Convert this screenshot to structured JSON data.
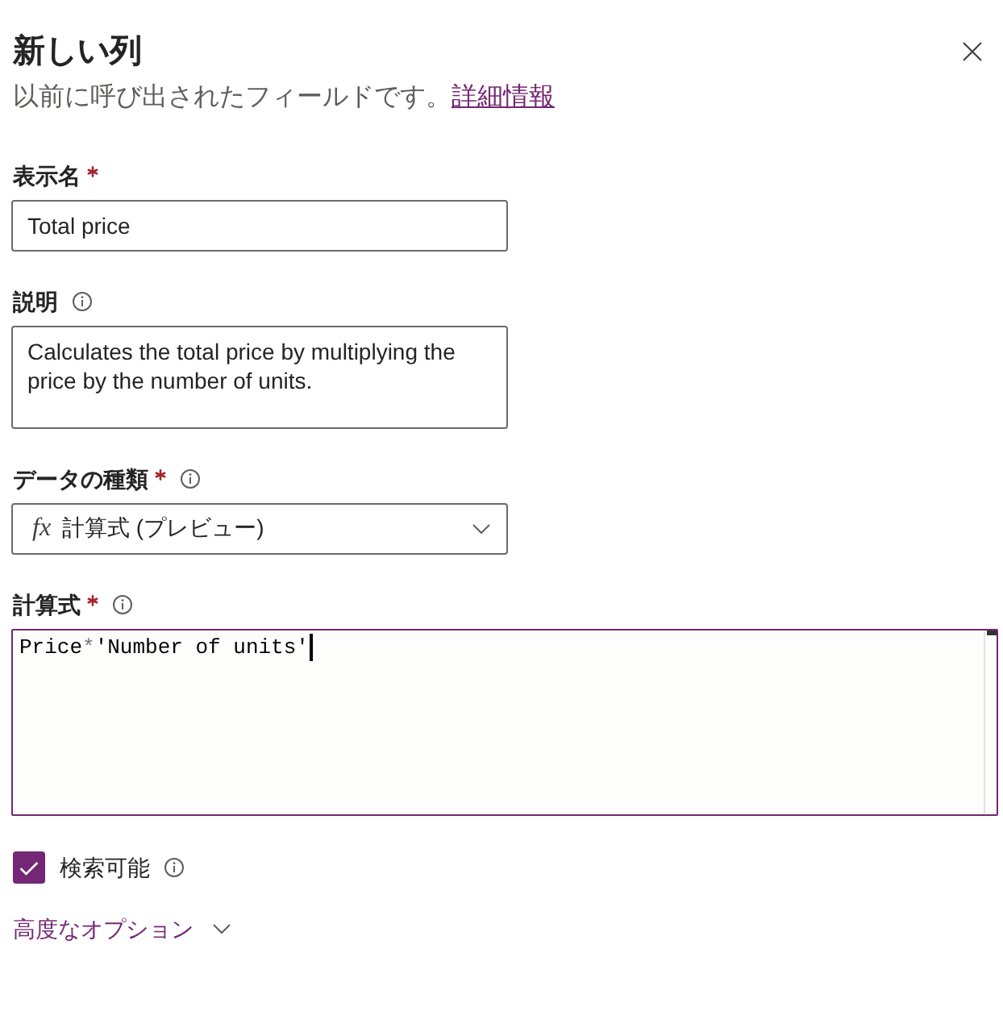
{
  "panel": {
    "title": "新しい列",
    "subtitle": "以前に呼び出されたフィールドです。",
    "link": "詳細情報"
  },
  "fields": [
    {
      "kind": "text",
      "label": "表示名",
      "required": true,
      "info": false,
      "value": "Total price"
    },
    {
      "kind": "textarea",
      "label": "説明",
      "required": false,
      "info": true,
      "value": "Calculates the total price by multiplying the price by the number of units."
    },
    {
      "kind": "dropdown",
      "label": "データの種類",
      "required": true,
      "info": true,
      "symbol": "fx",
      "value": "計算式 (プレビュー)"
    },
    {
      "kind": "formula",
      "label": "計算式",
      "required": true,
      "info": true,
      "focused": true,
      "tokens": [
        {
          "kind": "identifier",
          "text": "Price"
        },
        {
          "kind": "operator",
          "text": "*"
        },
        {
          "kind": "identifier",
          "text": "'Number of units'"
        }
      ]
    }
  ],
  "searchable": {
    "label": "検索可能",
    "checked": true,
    "info": true
  },
  "advanced_options": {
    "label": "高度なオプション",
    "expanded": false
  }
}
